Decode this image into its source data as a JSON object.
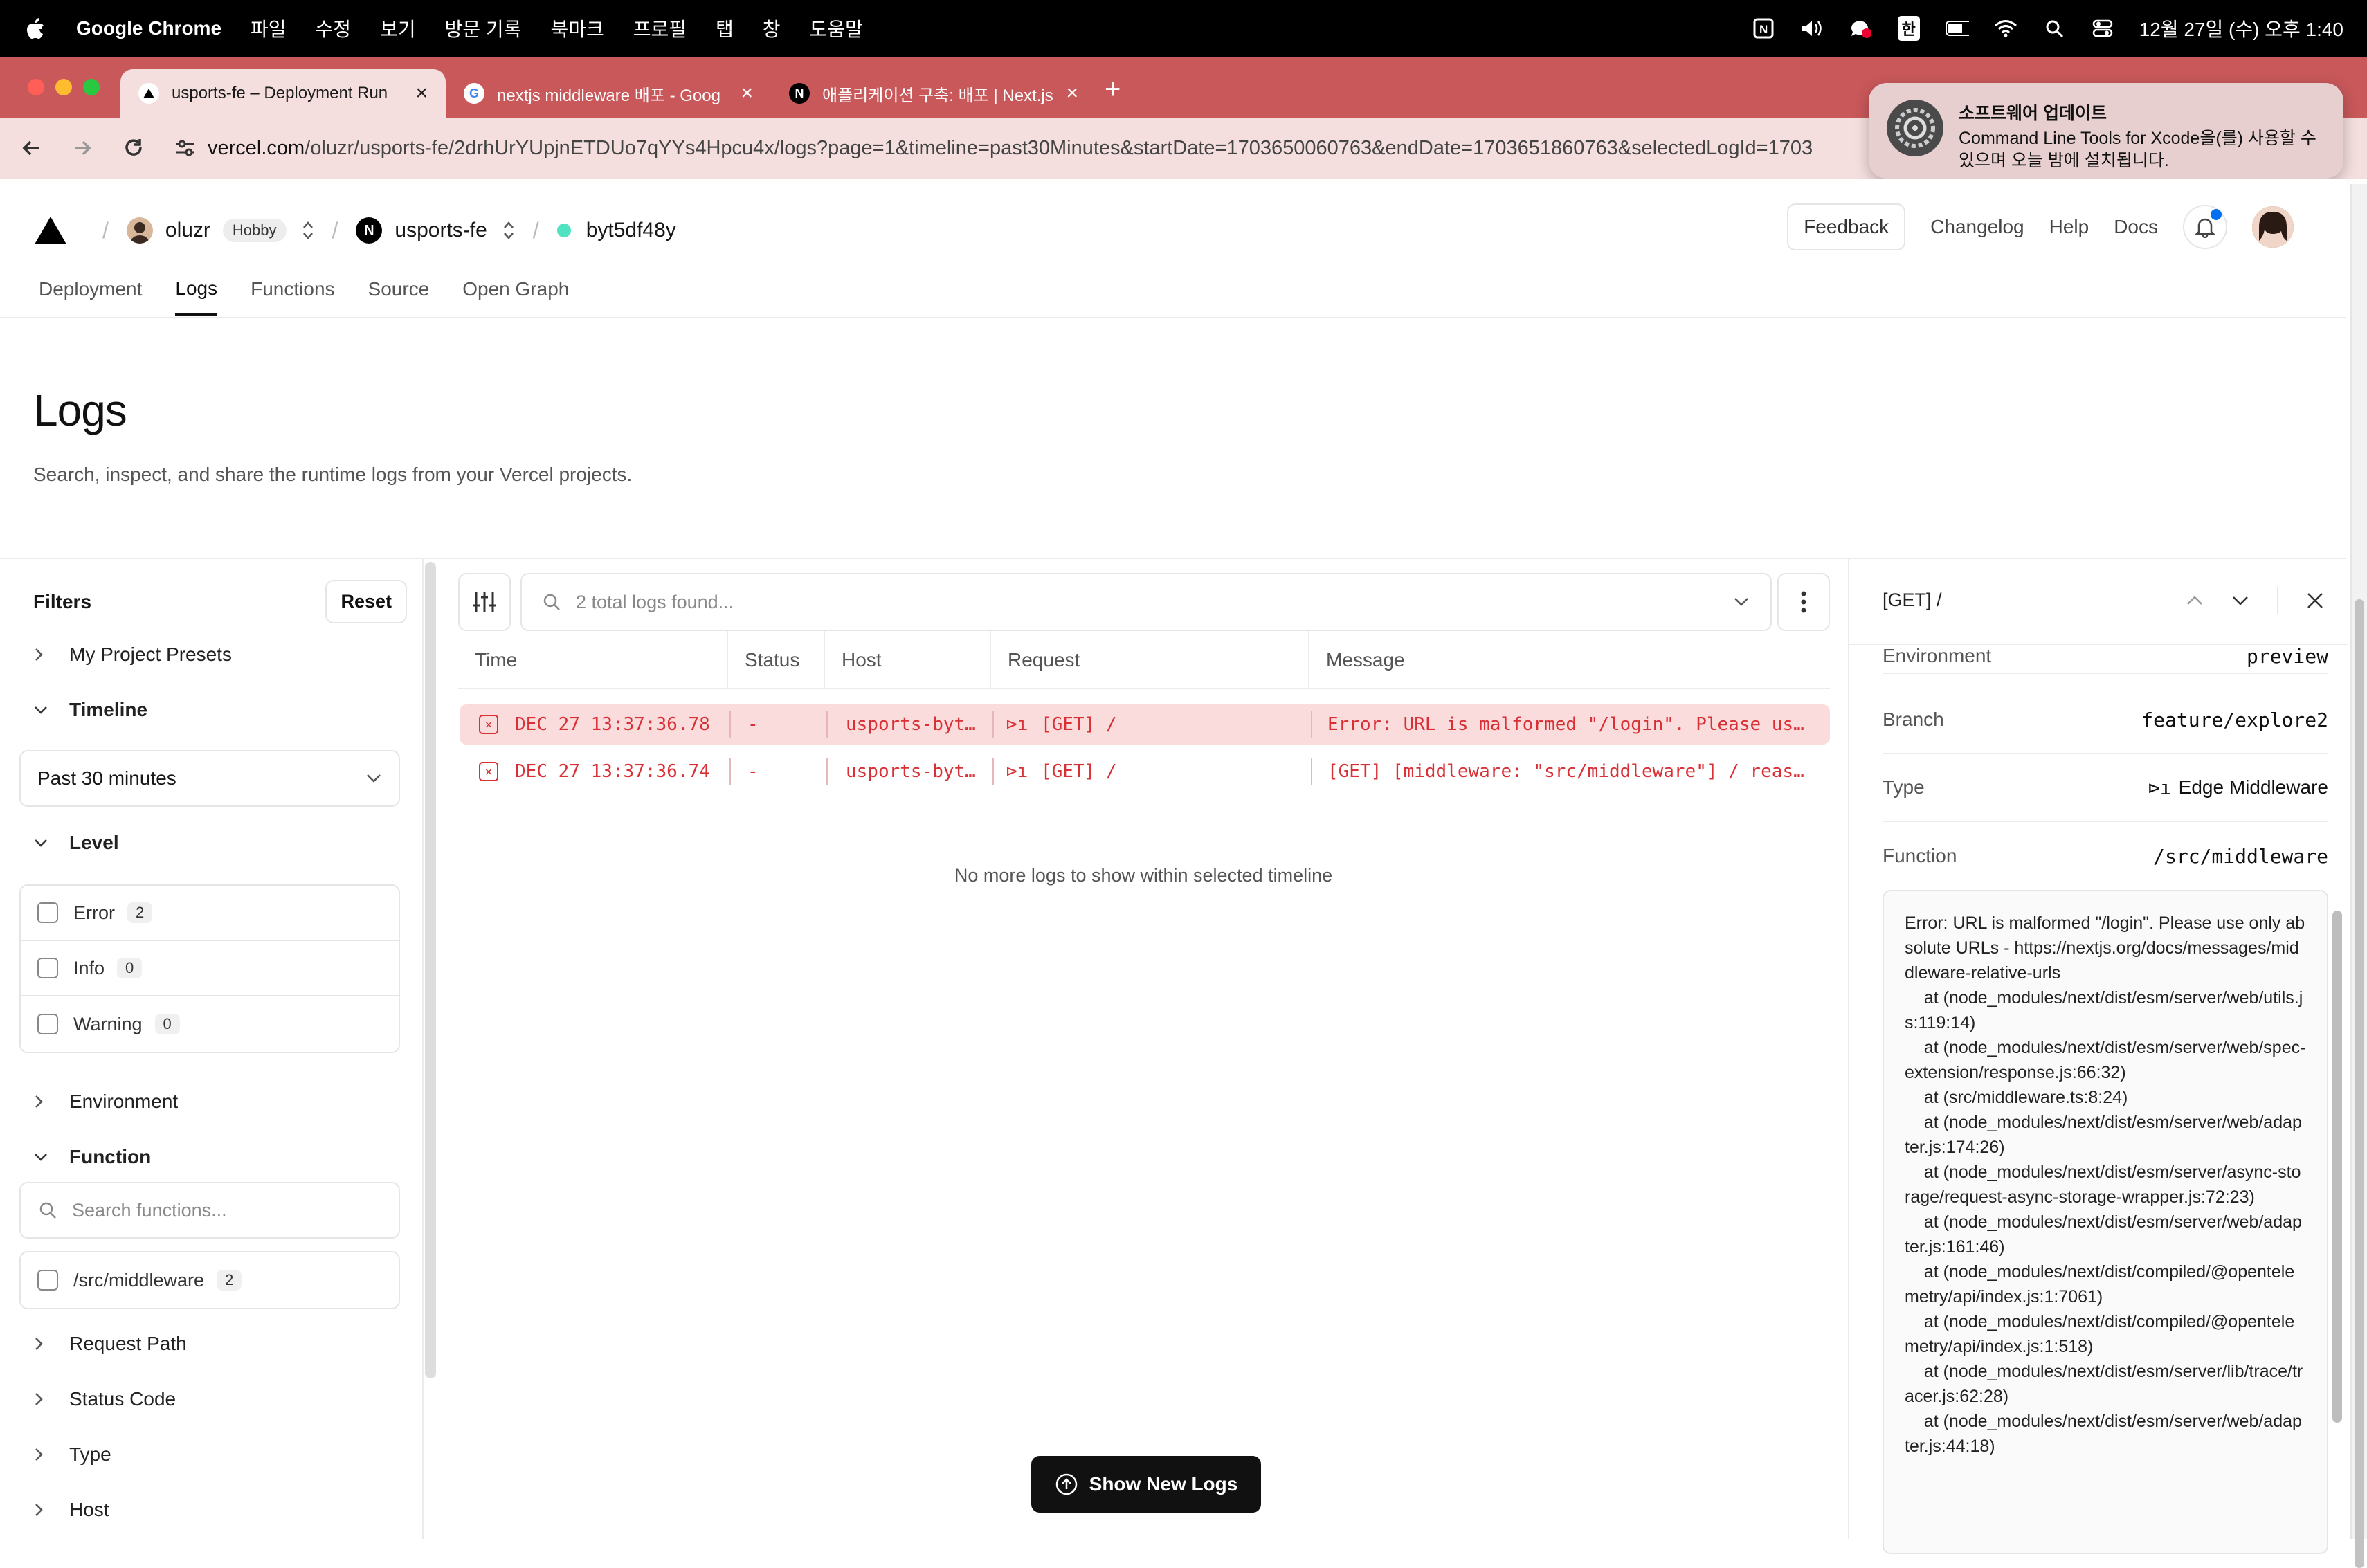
{
  "menubar": {
    "app_name": "Google Chrome",
    "items": [
      "파일",
      "수정",
      "보기",
      "방문 기록",
      "북마크",
      "프로필",
      "탭",
      "창",
      "도움말"
    ],
    "ime": "한",
    "clock": "12월 27일 (수) 오후 1:40"
  },
  "tabs": [
    {
      "title": "usports-fe – Deployment Run",
      "favicon": "vercel-triangle",
      "active": true
    },
    {
      "title": "nextjs middleware 배포 - Goog",
      "favicon": "G",
      "active": false
    },
    {
      "title": "애플리케이션 구축: 배포 | Next.js",
      "favicon": "N",
      "active": false
    }
  ],
  "address": {
    "domain": "vercel.com",
    "path": "/oluzr/usports-fe/2drhUrYUpjnETDUo7qYYs4Hpcu4x/logs?page=1&timeline=past30Minutes&startDate=1703650060763&endDate=1703651860763&selectedLogId=1703"
  },
  "notification": {
    "title": "소프트웨어 업데이트",
    "body": "Command Line Tools for Xcode을(를) 사용할 수 있으며 오늘 밤에 설치됩니다."
  },
  "header": {
    "user": "oluzr",
    "plan": "Hobby",
    "project": "usports-fe",
    "project_logo": "N",
    "deployment": "byt5df48y",
    "links": [
      "Feedback",
      "Changelog",
      "Help",
      "Docs"
    ],
    "subnav": [
      "Deployment",
      "Logs",
      "Functions",
      "Source",
      "Open Graph"
    ],
    "active_subnav": "Logs"
  },
  "page": {
    "title": "Logs",
    "subtitle": "Search, inspect, and share the runtime logs from your Vercel projects."
  },
  "filters": {
    "title": "Filters",
    "reset": "Reset",
    "my_presets": "My Project Presets",
    "timeline_label": "Timeline",
    "timeline_value": "Past 30 minutes",
    "level_label": "Level",
    "levels": [
      {
        "name": "Error",
        "count": "2"
      },
      {
        "name": "Info",
        "count": "0"
      },
      {
        "name": "Warning",
        "count": "0"
      }
    ],
    "environment": "Environment",
    "function_label": "Function",
    "function_search_placeholder": "Search functions...",
    "functions": [
      {
        "name": "/src/middleware",
        "count": "2"
      }
    ],
    "request_path": "Request Path",
    "status_code": "Status Code",
    "type": "Type",
    "host": "Host"
  },
  "logs": {
    "search_placeholder": "2 total logs found...",
    "columns": [
      "Time",
      "Status",
      "Host",
      "Request",
      "Message"
    ],
    "rows": [
      {
        "time": "DEC 27 13:37:36.78",
        "status": "-",
        "host": "usports-byt…",
        "request": "[GET] /",
        "message": "Error: URL is malformed \"/login\". Please us…"
      },
      {
        "time": "DEC 27 13:37:36.74",
        "status": "-",
        "host": "usports-byt…",
        "request": "[GET] /",
        "message": "[GET] [middleware: \"src/middleware\"] / reas…"
      }
    ],
    "no_more": "No more logs to show within selected timeline",
    "show_new": "Show New Logs"
  },
  "detail": {
    "title": "[GET] /",
    "fields": [
      {
        "key": "Environment",
        "value": "preview"
      },
      {
        "key": "Branch",
        "value": "feature/explore2"
      },
      {
        "key": "Type",
        "value": "Edge Middleware"
      },
      {
        "key": "Function",
        "value": "/src/middleware"
      }
    ],
    "error": "Error: URL is malformed \"/login\". Please use only absolute URLs - https://nextjs.org/docs/messages/middleware-relative-urls\n    at (node_modules/next/dist/esm/server/web/utils.js:119:14)\n    at (node_modules/next/dist/esm/server/web/spec-extension/response.js:66:32)\n    at (src/middleware.ts:8:24)\n    at (node_modules/next/dist/esm/server/web/adapter.js:174:26)\n    at (node_modules/next/dist/esm/server/async-storage/request-async-storage-wrapper.js:72:23)\n    at (node_modules/next/dist/esm/server/web/adapter.js:161:46)\n    at (node_modules/next/dist/compiled/@opentelemetry/api/index.js:1:7061)\n    at (node_modules/next/dist/compiled/@opentelemetry/api/index.js:1:518)\n    at (node_modules/next/dist/esm/server/lib/trace/tracer.js:62:28)\n    at (node_modules/next/dist/esm/server/web/adapter.js:44:18)"
  },
  "colors": {
    "tabbar": "#c8585a",
    "error_red": "#d93036",
    "error_row_bg": "#fbdcdc",
    "deploy_dot": "#50e3c2"
  }
}
